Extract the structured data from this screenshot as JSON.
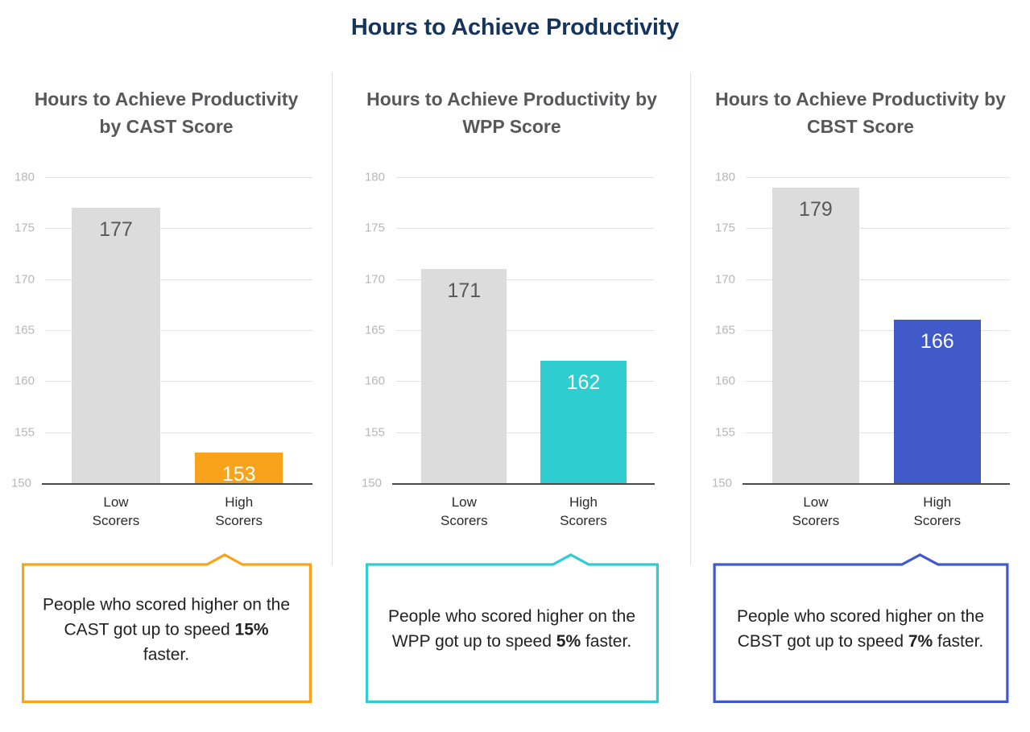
{
  "title": "Hours to Achieve Productivity",
  "colors": {
    "title": "#16355D",
    "subtitle": "#58585B",
    "gray_bar": "#DCDCDC",
    "gridline": "#E4E4E4",
    "axis": "#4A4A4A",
    "tick_label": "#B7B7B7",
    "cast_accent": "#F9A21B",
    "wpp_accent": "#2FCDD0",
    "cbst_accent": "#4159C9"
  },
  "axis": {
    "ticks": [
      "180",
      "175",
      "170",
      "165",
      "160",
      "155",
      "150"
    ],
    "min": 150,
    "max": 180
  },
  "categories": [
    "Low\nScorers",
    "High\nScorers"
  ],
  "cat_line1": [
    "Low",
    "High"
  ],
  "cat_line2": [
    "Scorers",
    "Scorers"
  ],
  "panels": [
    {
      "subtitle": "Hours to Achieve Productivity by CAST Score",
      "accent": "#F9A21B",
      "low_label": "177",
      "high_label": "153",
      "callout_prefix": "People who scored higher on the CAST got up to speed ",
      "callout_bold": "15%",
      "callout_suffix": " faster."
    },
    {
      "subtitle": "Hours to Achieve Productivity by WPP Score",
      "accent": "#2FCDD0",
      "low_label": "171",
      "high_label": "162",
      "callout_prefix": "People who scored higher on the WPP got up to speed ",
      "callout_bold": "5%",
      "callout_suffix": " faster."
    },
    {
      "subtitle": "Hours to Achieve Productivity by CBST Score",
      "accent": "#4159C9",
      "low_label": "179",
      "high_label": "166",
      "callout_prefix": "People who scored higher on the CBST got up to speed ",
      "callout_bold": "7%",
      "callout_suffix": " faster."
    }
  ],
  "chart_data": [
    {
      "type": "bar",
      "title": "Hours to Achieve Productivity by CAST Score",
      "categories": [
        "Low Scorers",
        "High Scorers"
      ],
      "values": [
        177,
        153
      ],
      "colors": [
        "#DCDCDC",
        "#F9A21B"
      ],
      "xlabel": "",
      "ylabel": "",
      "ylim": [
        150,
        180
      ],
      "yticks": [
        150,
        155,
        160,
        165,
        170,
        175,
        180
      ],
      "grid": true,
      "legend": "none",
      "annotation": "People who scored higher on the CAST got up to speed 15% faster."
    },
    {
      "type": "bar",
      "title": "Hours to Achieve Productivity by WPP Score",
      "categories": [
        "Low Scorers",
        "High Scorers"
      ],
      "values": [
        171,
        162
      ],
      "colors": [
        "#DCDCDC",
        "#2FCDD0"
      ],
      "xlabel": "",
      "ylabel": "",
      "ylim": [
        150,
        180
      ],
      "yticks": [
        150,
        155,
        160,
        165,
        170,
        175,
        180
      ],
      "grid": true,
      "legend": "none",
      "annotation": "People who scored higher on the WPP got up to speed 5% faster."
    },
    {
      "type": "bar",
      "title": "Hours to Achieve Productivity by CBST Score",
      "categories": [
        "Low Scorers",
        "High Scorers"
      ],
      "values": [
        179,
        166
      ],
      "colors": [
        "#DCDCDC",
        "#4159C9"
      ],
      "xlabel": "",
      "ylabel": "",
      "ylim": [
        150,
        180
      ],
      "yticks": [
        150,
        155,
        160,
        165,
        170,
        175,
        180
      ],
      "grid": true,
      "legend": "none",
      "annotation": "People who scored higher on the CBST got up to speed 7% faster."
    }
  ]
}
